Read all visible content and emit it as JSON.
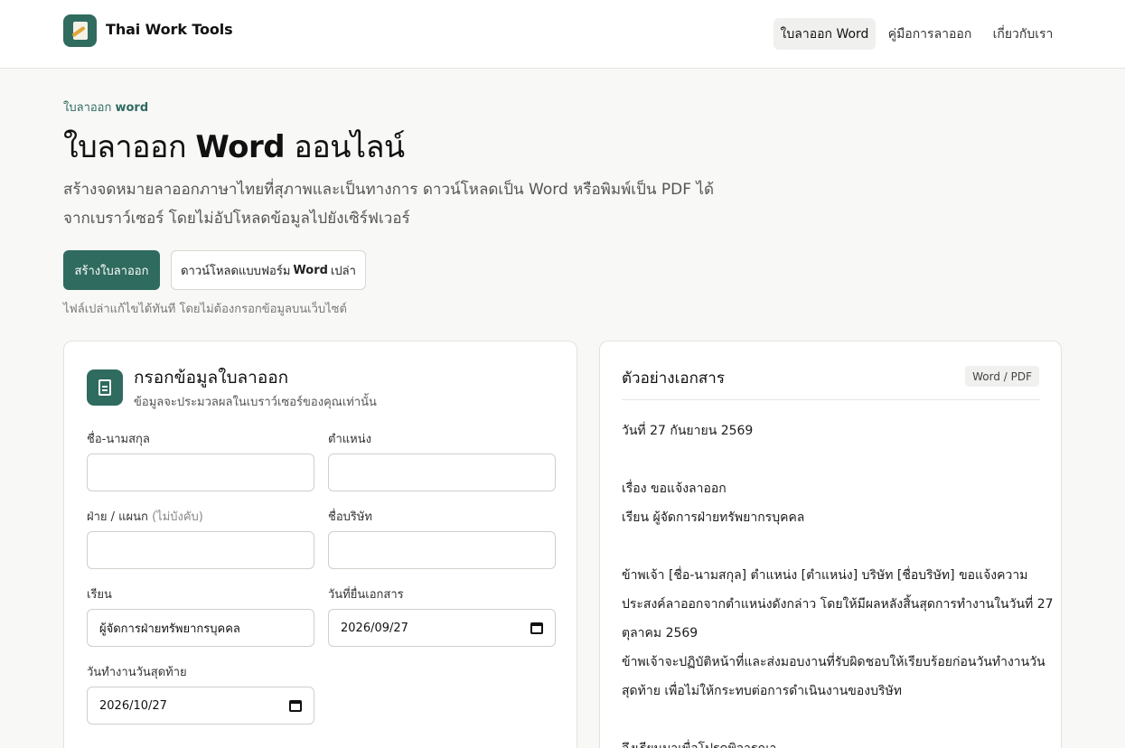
{
  "header": {
    "brand": "Thai Work Tools",
    "nav": [
      "ใบลาออก Word",
      "คู่มือการลาออก",
      "เกี่ยวกับเรา"
    ]
  },
  "hero": {
    "eyebrow_prefix": "ใบลาออก ",
    "eyebrow_word": "word",
    "title_prefix": "ใบลาออก ",
    "title_word": "Word",
    "title_suffix": " ออนไลน์",
    "lead": "สร้างจดหมายลาออกภาษาไทยที่สุภาพและเป็นทางการ ดาวน์โหลดเป็น Word หรือพิมพ์เป็น PDF ได้จากเบราว์เซอร์ โดยไม่อัปโหลดข้อมูลไปยังเซิร์ฟเวอร์",
    "primary_button": "สร้างใบลาออก",
    "secondary_prefix": "ดาวน์โหลดแบบฟอร์ม",
    "secondary_word": "Word",
    "secondary_suffix": "เปล่า",
    "hint": "ไฟล์เปล่าแก้ไขได้ทันที โดยไม่ต้องกรอกข้อมูลบนเว็บไซต์"
  },
  "form": {
    "title": "กรอกข้อมูลใบลาออก",
    "subtitle": "ข้อมูลจะประมวลผลในเบราว์เซอร์ของคุณเท่านั้น",
    "fields": {
      "name": {
        "label": "ชื่อ-นามสกุล",
        "value": ""
      },
      "position": {
        "label": "ตำแหน่ง",
        "value": ""
      },
      "department": {
        "label": "ฝ่าย / แผนก",
        "optional": "(ไม่บังคับ)",
        "value": ""
      },
      "company": {
        "label": "ชื่อบริษัท",
        "value": ""
      },
      "recipient": {
        "label": "เรียน",
        "value": "ผู้จัดการฝ่ายทรัพยากรบุคคล"
      },
      "submit_date": {
        "label": "วันที่ยื่นเอกสาร",
        "value": "2026/09/27"
      },
      "last_day": {
        "label": "วันทำงานวันสุดท้าย",
        "value": "2026/10/27"
      }
    }
  },
  "preview": {
    "title": "ตัวอย่างเอกสาร",
    "badge": "Word / PDF",
    "lines": [
      "วันที่ 27 กันยายน 2569",
      "เรื่อง ขอแจ้งลาออก",
      "เรียน ผู้จัดการฝ่ายทรัพยากรบุคคล",
      "ข้าพเจ้า [ชื่อ-นามสกุล] ตำแหน่ง [ตำแหน่ง] บริษัท [ชื่อบริษัท] ขอแจ้งความ",
      "ประสงค์ลาออกจากตำแหน่งดังกล่าว โดยให้มีผลหลังสิ้นสุดการทำงานในวันที่ 27",
      "ตุลาคม 2569",
      "ข้าพเจ้าจะปฏิบัติหน้าที่และส่งมอบงานที่รับผิดชอบให้เรียบร้อยก่อนวันทำงานวัน",
      "สุดท้าย เพื่อไม่ให้กระทบต่อการดำเนินงานของบริษัท",
      "จึงเรียนมาเพื่อโปรดพิจารณา"
    ]
  }
}
